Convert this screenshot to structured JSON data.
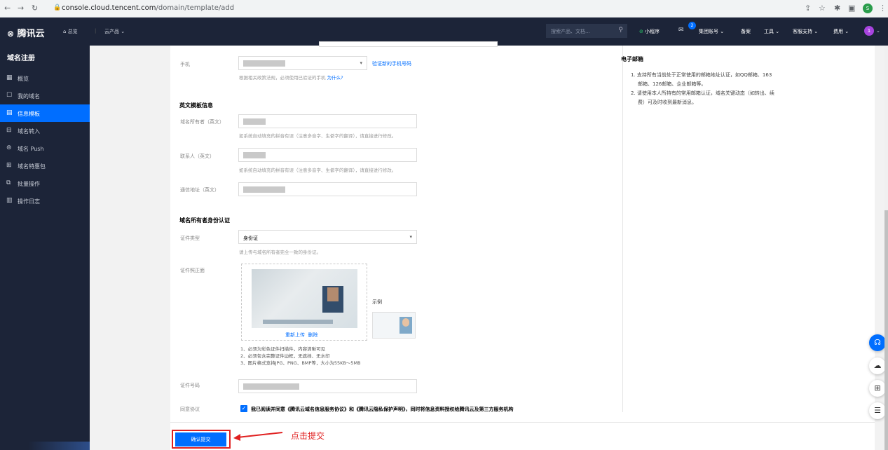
{
  "browser": {
    "url_host": "console.cloud.tencent.com",
    "url_path": "/domain/template/add",
    "profile_initial": "S"
  },
  "topbar": {
    "logo": "腾讯云",
    "home": "总览",
    "products": "云产品",
    "search_placeholder": "搜索产品、文档...",
    "mini_program": "小程序",
    "message_count": "2",
    "group_account": "集团账号",
    "filing": "备案",
    "tools": "工具",
    "support": "客服支持",
    "billing": "费用",
    "avatar_initial": "1"
  },
  "sidebar": {
    "title": "域名注册",
    "items": [
      {
        "label": "概览",
        "icon": "grid-icon"
      },
      {
        "label": "我的域名",
        "icon": "square-icon"
      },
      {
        "label": "信息模板",
        "icon": "document-icon"
      },
      {
        "label": "域名转入",
        "icon": "transfer-icon"
      },
      {
        "label": "域名 Push",
        "icon": "push-icon"
      },
      {
        "label": "域名特惠包",
        "icon": "gift-icon"
      },
      {
        "label": "批量操作",
        "icon": "batch-icon"
      },
      {
        "label": "操作日志",
        "icon": "calendar-icon"
      }
    ]
  },
  "form": {
    "phone_label": "手机",
    "phone_link": "验证新的手机号码",
    "phone_hint": "根据相关政策法规，必须使用已验证的手机",
    "phone_hint_link": "为什么?",
    "english_section": "英文模板信息",
    "owner_en_label": "域名所有者（英文）",
    "owner_en_hint": "如系统自动填充的拼音有误（注意多音字、生僻字的翻译），请直接进行修改。",
    "contact_en_label": "联系人（英文）",
    "contact_en_hint": "如系统自动填充的拼音有误（注意多音字、生僻字的翻译），请直接进行修改。",
    "address_en_label": "通信地址（英文）",
    "identity_section": "域名所有者身份认证",
    "cert_type_label": "证件类型",
    "cert_type_value": "身份证",
    "cert_type_hint": "请上传与域名所有者完全一致的身份证。",
    "cert_front_label": "证件照正面",
    "reupload": "重新上传",
    "delete": "删除",
    "example": "示例",
    "requirements": [
      "1、必须为彩色证件扫描件，内容清晰可见",
      "2、必须包含完整证件边框，无遮挡、无水印",
      "3、图片格式支持JPG、PNG、BMP等，大小为55KB～5MB"
    ],
    "cert_number_label": "证件号码",
    "agree_label": "同意协议",
    "agree_text": "我已阅读并同意《腾讯云域名信息服务协议》和《腾讯云隐私保护声明》，同时将信息资料授权给腾讯云及第三方服务机构",
    "agree_checked": true,
    "submit": "确认提交",
    "annotation": "点击提交"
  },
  "right_panel": {
    "title": "电子邮箱",
    "line1": "1. 支持所有当前处于正常使用的邮箱地址认证，如QQ邮箱、163",
    "line2": "邮箱、126邮箱、企业邮箱等。",
    "line3": "2. 请使用本人所持有的常用邮箱认证，域名关键动态（如转出、续",
    "line4": "费）可及时收到最新消息。"
  },
  "colors": {
    "accent": "#006eff",
    "sidebar_bg": "#1c2438",
    "annotation": "#e02020"
  }
}
